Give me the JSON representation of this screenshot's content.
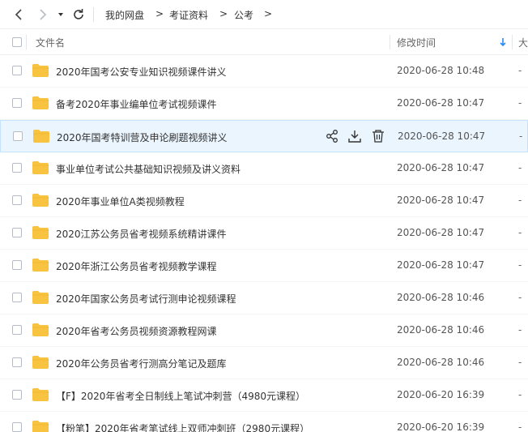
{
  "nav": {
    "back_icon": "chevron-left-icon",
    "forward_icon": "chevron-right-icon",
    "dropdown_icon": "caret-down-icon",
    "refresh_icon": "refresh-icon"
  },
  "breadcrumb": {
    "items": [
      "我的网盘",
      "考证资料",
      "公考"
    ],
    "separator": ">"
  },
  "columns": {
    "name": "文件名",
    "modified": "修改时间",
    "size": "大",
    "sort_icon": "sort-down-arrow-icon"
  },
  "colors": {
    "folder": "#f7c341",
    "hover_row": "#eaf5fe",
    "accent": "#2a8bf2"
  },
  "rows": [
    {
      "name": "2020年国考公安专业知识视频课件讲义",
      "date": "2020-06-28 10:48",
      "size": "-"
    },
    {
      "name": "备考2020年事业编单位考试视频课件",
      "date": "2020-06-28 10:47",
      "size": "-"
    },
    {
      "name": "2020年国考特训营及申论刷题视频讲义",
      "date": "2020-06-28 10:47",
      "size": "-",
      "hover": true
    },
    {
      "name": "事业单位考试公共基础知识视频及讲义资料",
      "date": "2020-06-28 10:47",
      "size": "-"
    },
    {
      "name": "2020年事业单位A类视频教程",
      "date": "2020-06-28 10:47",
      "size": "-"
    },
    {
      "name": "2020江苏公务员省考视频系统精讲课件",
      "date": "2020-06-28 10:47",
      "size": "-"
    },
    {
      "name": "2020年浙江公务员省考视频教学课程",
      "date": "2020-06-28 10:47",
      "size": "-"
    },
    {
      "name": "2020年国家公务员考试行测申论视频课程",
      "date": "2020-06-28 10:46",
      "size": "-"
    },
    {
      "name": "2020年省考公务员视频资源教程网课",
      "date": "2020-06-28 10:46",
      "size": "-"
    },
    {
      "name": "2020年公务员省考行测高分笔记及题库",
      "date": "2020-06-28 10:46",
      "size": "-"
    },
    {
      "name": "【F】2020年省考全日制线上笔试冲刺营（4980元课程）",
      "date": "2020-06-20 16:39",
      "size": "-"
    },
    {
      "name": "【粉笔】2020年省考笔试线上双师冲刺班（2980元课程）",
      "date": "2020-06-20 16:39",
      "size": "-"
    }
  ],
  "row_actions": [
    "share-icon",
    "download-icon",
    "delete-icon"
  ]
}
